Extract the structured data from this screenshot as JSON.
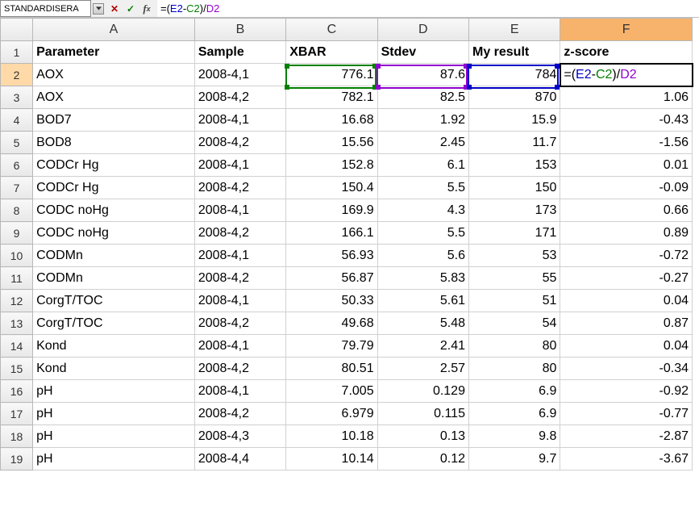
{
  "formula_bar": {
    "name_box": "STANDARDISERA",
    "formula_raw": "=(E2-C2)/D2",
    "parts": [
      {
        "text": "=(",
        "cls": "part-plain"
      },
      {
        "text": "E2",
        "cls": "part-e"
      },
      {
        "text": "-",
        "cls": "part-plain"
      },
      {
        "text": "C2",
        "cls": "part-c"
      },
      {
        "text": ")/",
        "cls": "part-plain"
      },
      {
        "text": "D2",
        "cls": "part-d"
      }
    ]
  },
  "columns": [
    "A",
    "B",
    "C",
    "D",
    "E",
    "F"
  ],
  "headers": {
    "A": "Parameter",
    "B": "Sample",
    "C": "XBAR",
    "D": "Stdev",
    "E": "My result",
    "F": "z-score"
  },
  "active_cell_formula_parts": [
    {
      "text": "=(",
      "cls": "part-plain"
    },
    {
      "text": "E2",
      "cls": "part-e"
    },
    {
      "text": "-",
      "cls": "part-plain"
    },
    {
      "text": "C2",
      "cls": "part-c"
    },
    {
      "text": ")/",
      "cls": "part-plain"
    },
    {
      "text": "D2",
      "cls": "part-d"
    }
  ],
  "rows": [
    {
      "n": 2,
      "A": "AOX",
      "B": "2008-4,1",
      "C": "776.1",
      "D": "87.6",
      "E": "784",
      "F": null
    },
    {
      "n": 3,
      "A": "AOX",
      "B": "2008-4,2",
      "C": "782.1",
      "D": "82.5",
      "E": "870",
      "F": "1.06"
    },
    {
      "n": 4,
      "A": "BOD7",
      "B": "2008-4,1",
      "C": "16.68",
      "D": "1.92",
      "E": "15.9",
      "F": "-0.43"
    },
    {
      "n": 5,
      "A": "BOD8",
      "B": "2008-4,2",
      "C": "15.56",
      "D": "2.45",
      "E": "11.7",
      "F": "-1.56"
    },
    {
      "n": 6,
      "A": "CODCr Hg",
      "B": "2008-4,1",
      "C": "152.8",
      "D": "6.1",
      "E": "153",
      "F": "0.01"
    },
    {
      "n": 7,
      "A": "CODCr Hg",
      "B": "2008-4,2",
      "C": "150.4",
      "D": "5.5",
      "E": "150",
      "F": "-0.09"
    },
    {
      "n": 8,
      "A": "CODC noHg",
      "B": "2008-4,1",
      "C": "169.9",
      "D": "4.3",
      "E": "173",
      "F": "0.66"
    },
    {
      "n": 9,
      "A": "CODC noHg",
      "B": "2008-4,2",
      "C": "166.1",
      "D": "5.5",
      "E": "171",
      "F": "0.89"
    },
    {
      "n": 10,
      "A": "CODMn",
      "B": "2008-4,1",
      "C": "56.93",
      "D": "5.6",
      "E": "53",
      "F": "-0.72"
    },
    {
      "n": 11,
      "A": "CODMn",
      "B": "2008-4,2",
      "C": "56.87",
      "D": "5.83",
      "E": "55",
      "F": "-0.27"
    },
    {
      "n": 12,
      "A": "CorgT/TOC",
      "B": "2008-4,1",
      "C": "50.33",
      "D": "5.61",
      "E": "51",
      "F": "0.04"
    },
    {
      "n": 13,
      "A": "CorgT/TOC",
      "B": "2008-4,2",
      "C": "49.68",
      "D": "5.48",
      "E": "54",
      "F": "0.87"
    },
    {
      "n": 14,
      "A": "Kond",
      "B": "2008-4,1",
      "C": "79.79",
      "D": "2.41",
      "E": "80",
      "F": "0.04"
    },
    {
      "n": 15,
      "A": "Kond",
      "B": "2008-4,2",
      "C": "80.51",
      "D": "2.57",
      "E": "80",
      "F": "-0.34"
    },
    {
      "n": 16,
      "A": "pH",
      "B": "2008-4,1",
      "C": "7.005",
      "D": "0.129",
      "E": "6.9",
      "F": "-0.92"
    },
    {
      "n": 17,
      "A": "pH",
      "B": "2008-4,2",
      "C": "6.979",
      "D": "0.115",
      "E": "6.9",
      "F": "-0.77"
    },
    {
      "n": 18,
      "A": "pH",
      "B": "2008-4,3",
      "C": "10.18",
      "D": "0.13",
      "E": "9.8",
      "F": "-2.87"
    },
    {
      "n": 19,
      "A": "pH",
      "B": "2008-4,4",
      "C": "10.14",
      "D": "0.12",
      "E": "9.7",
      "F": "-3.67"
    }
  ]
}
